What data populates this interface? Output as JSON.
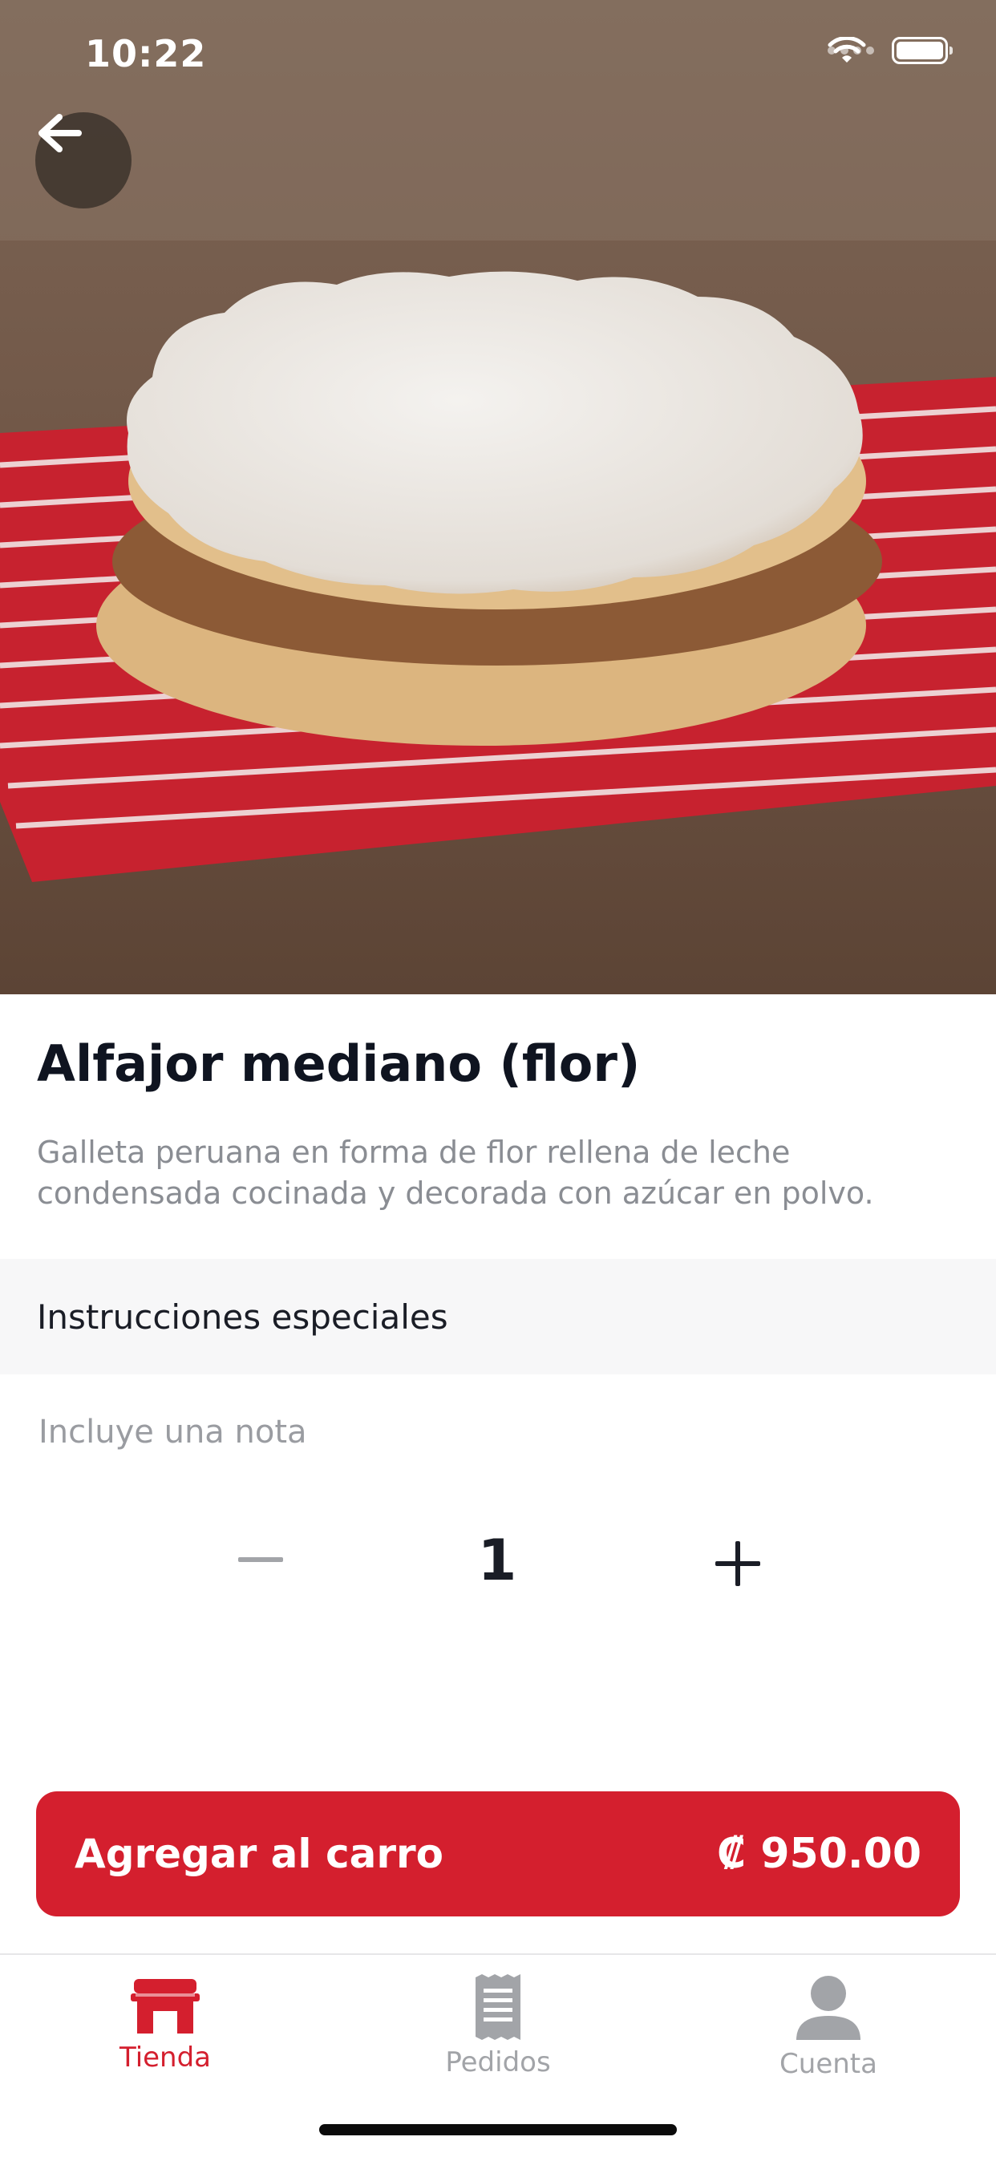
{
  "status_bar": {
    "time": "10:22"
  },
  "product": {
    "name": "Alfajor mediano (flor)",
    "description": "Galleta peruana en forma de flor rellena de leche condensada cocinada y decorada con azúcar en polvo.",
    "image_alt": "alfajor-photo"
  },
  "special_instructions": {
    "title": "Instrucciones especiales",
    "note_placeholder": "Incluye una nota",
    "note_value": ""
  },
  "quantity": {
    "value": "1",
    "minus_icon": "minus-icon",
    "plus_icon": "plus-icon"
  },
  "add_to_cart": {
    "label": "Agregar al carro",
    "price": "₡ 950.00"
  },
  "tabs": [
    {
      "label": "Tienda",
      "icon": "store-icon",
      "active": true
    },
    {
      "label": "Pedidos",
      "icon": "receipt-icon",
      "active": false
    },
    {
      "label": "Cuenta",
      "icon": "person-icon",
      "active": false
    }
  ],
  "colors": {
    "accent": "#d41f2e",
    "title_text": "#0f1420",
    "muted_text": "#8a8d93",
    "inactive_tab": "#a2a4a8"
  }
}
